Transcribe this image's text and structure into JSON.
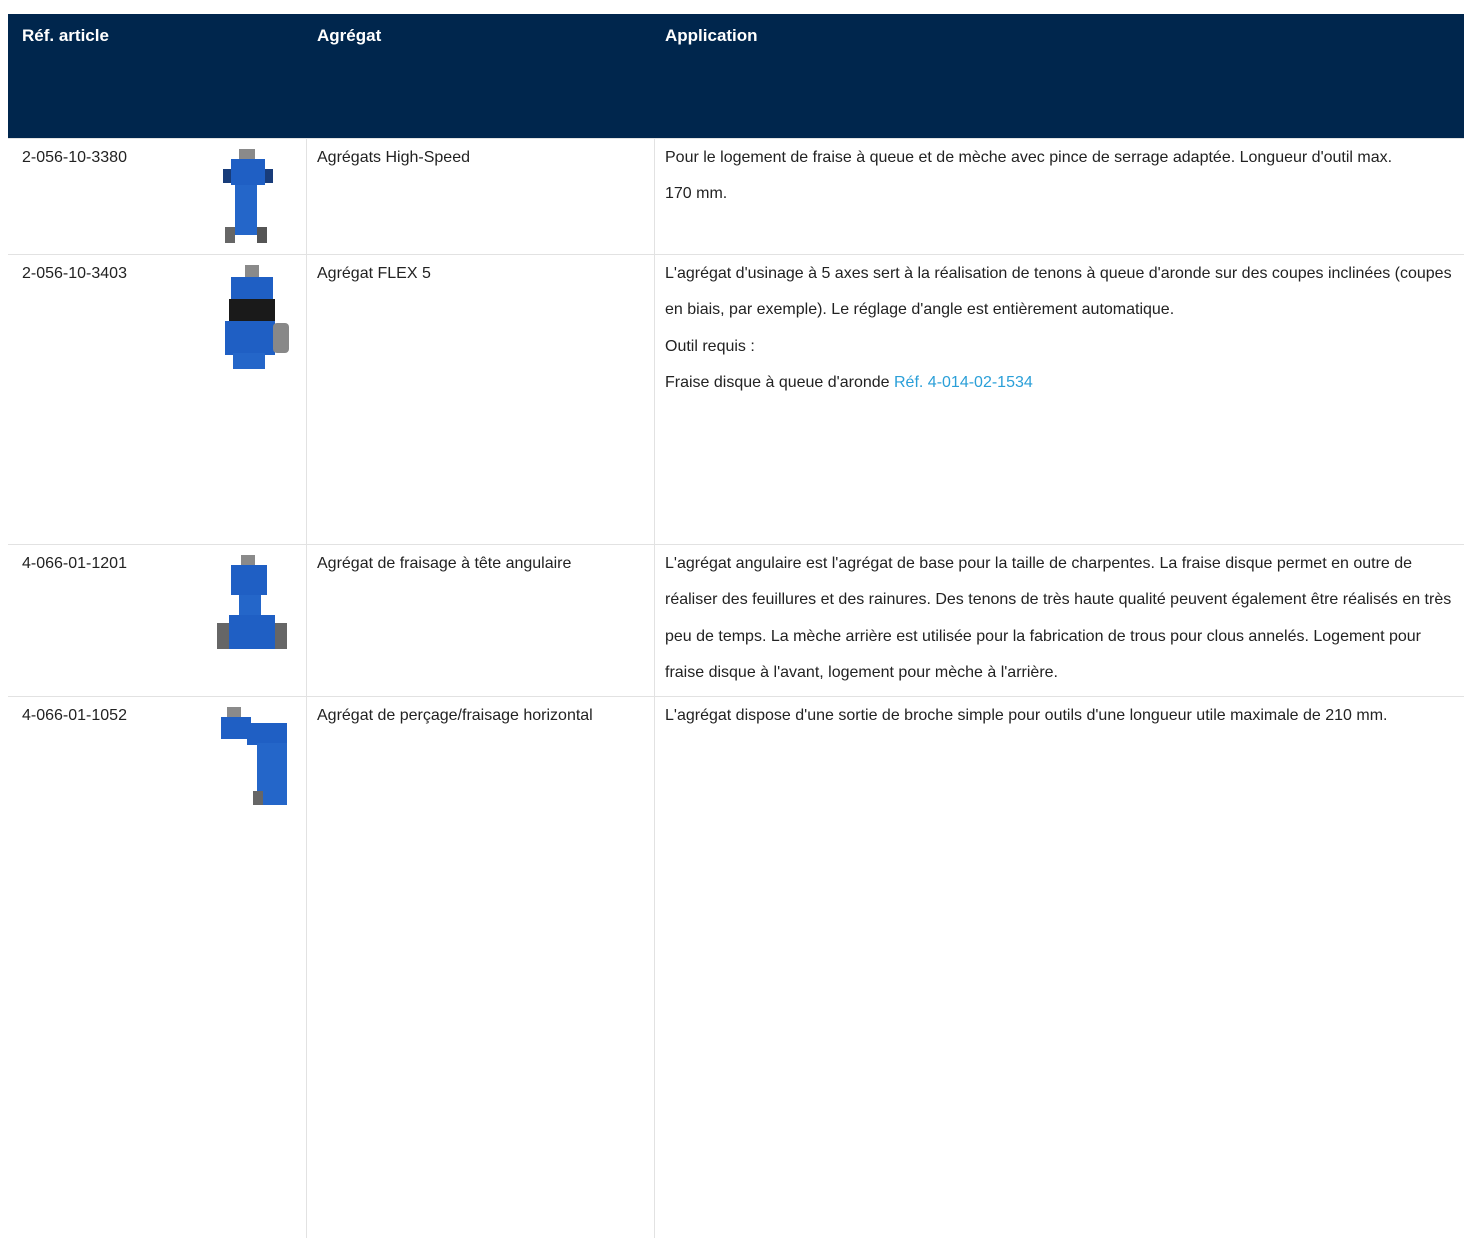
{
  "header": {
    "col_ref": "Réf. article",
    "col_aggregate": "Agrégat",
    "col_application": "Application"
  },
  "colors": {
    "header_bg": "#00264d",
    "link": "#2a9fd8",
    "product_blue": "#1f5fc4"
  },
  "rows": [
    {
      "ref": "2-056-10-3380",
      "image_icon": "high-speed-aggregate-image",
      "aggregate": "Agrégats High-Speed",
      "app_lines": [
        "Pour le logement de fraise à queue et de mèche avec pince de serrage adaptée. Longueur d'outil max.",
        "170 mm."
      ]
    },
    {
      "ref": "2-056-10-3403",
      "image_icon": "flex5-aggregate-image",
      "aggregate": "Agrégat FLEX 5",
      "app_lines": [
        "L'agrégat d'usinage à 5 axes sert à la réalisation de tenons à queue d'aronde sur des coupes inclinées (coupes en biais, par exemple). Le réglage d'angle est entièrement automatique.",
        "Outil requis :",
        "Fraise disque à queue d'aronde "
      ],
      "app_link": "Réf. 4-014-02-1534"
    },
    {
      "ref": "4-066-01-1201",
      "image_icon": "angular-head-aggregate-image",
      "aggregate": "Agrégat de fraisage à tête angulaire",
      "app_lines": [
        "L'agrégat angulaire est l'agrégat de base pour la taille de charpentes. La fraise disque permet en outre de réaliser des feuillures et des rainures. Des tenons de très haute qualité peuvent également être réalisés en très peu de temps. La mèche arrière est utilisée pour la fabrication de trous pour clous annelés. Logement pour fraise disque à l'avant, logement pour mèche à l'arrière."
      ]
    },
    {
      "ref": "4-066-01-1052",
      "image_icon": "horizontal-drill-aggregate-image",
      "aggregate": "Agrégat de perçage/fraisage horizontal",
      "app_lines": [
        "L'agrégat dispose d'une sortie de broche simple pour outils d'une longueur utile maximale de 210 mm."
      ]
    }
  ]
}
